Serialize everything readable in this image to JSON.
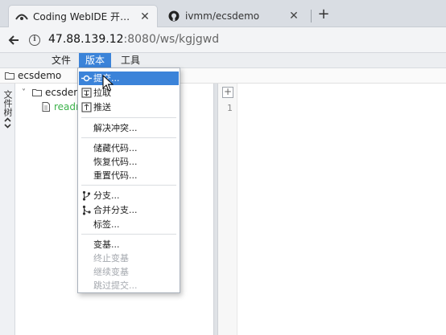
{
  "browser": {
    "tabs": [
      {
        "title": "Coding WebIDE 开启云端",
        "icon": "coding-logo-icon",
        "active": true
      },
      {
        "title": "ivmm/ecsdemo",
        "icon": "github-icon",
        "active": false
      }
    ],
    "close_glyph": "✕",
    "new_tab_glyph": "+",
    "url": {
      "host": "47.88.139.12",
      "rest": ":8080/ws/kgjgwd"
    }
  },
  "menubar": {
    "items": [
      "文件",
      "版本",
      "工具"
    ],
    "open_index": 1,
    "accent": "#3b83d9"
  },
  "breadcrumb": {
    "label": "ecsdemo"
  },
  "sidestrip": {
    "label": "文件树"
  },
  "tree": {
    "root": {
      "label": "ecsdem"
    },
    "file": {
      "label": "readm"
    }
  },
  "editor": {
    "add_glyph": "+",
    "line_number": "1"
  },
  "dropdown": {
    "items": [
      {
        "label": "提交...",
        "icon": "commit-icon",
        "highlighted": true
      },
      {
        "label": "拉取",
        "icon": "pull-icon"
      },
      {
        "label": "推送",
        "icon": "push-icon"
      },
      {
        "label": "解决冲突..."
      },
      {
        "label": "储藏代码..."
      },
      {
        "label": "恢复代码..."
      },
      {
        "label": "重置代码..."
      },
      {
        "label": "分支...",
        "icon": "branch-icon"
      },
      {
        "label": "合并分支...",
        "icon": "merge-icon"
      },
      {
        "label": "标签..."
      },
      {
        "label": "变基..."
      },
      {
        "label": "终止变基",
        "disabled": true
      },
      {
        "label": "继续变基",
        "disabled": true
      },
      {
        "label": "跳过提交...",
        "disabled": true
      }
    ]
  }
}
